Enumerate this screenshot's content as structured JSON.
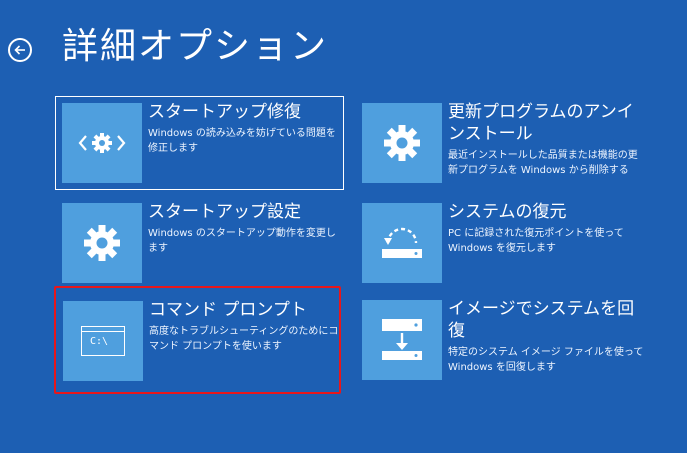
{
  "header": {
    "title": "詳細オプション"
  },
  "tiles": [
    {
      "title": "スタートアップ修復",
      "description": "Windows の読み込みを妨げている問題を修正します",
      "icon": "code-gear-icon"
    },
    {
      "title": "更新プログラムのアンインストール",
      "description": "最近インストールした品質または機能の更新プログラムを Windows から削除する",
      "icon": "gear-icon"
    },
    {
      "title": "スタートアップ設定",
      "description": "Windows のスタートアップ動作を変更します",
      "icon": "gear-icon"
    },
    {
      "title": "システムの復元",
      "description": "PC に記録された復元ポイントを使って Windows を復元します",
      "icon": "system-restore-icon"
    },
    {
      "title": "コマンド プロンプト",
      "description": "高度なトラブルシューティングのためにコマンド プロンプトを使います",
      "icon": "command-prompt-icon",
      "icon_text": "C:\\"
    },
    {
      "title": "イメージでシステムを回復",
      "description": "特定のシステム イメージ ファイルを使って Windows を回復します",
      "icon": "system-image-recovery-icon"
    }
  ],
  "colors": {
    "background": "#1d5fb3",
    "tile_icon": "#4f9fde",
    "highlight": "#e8171b"
  }
}
